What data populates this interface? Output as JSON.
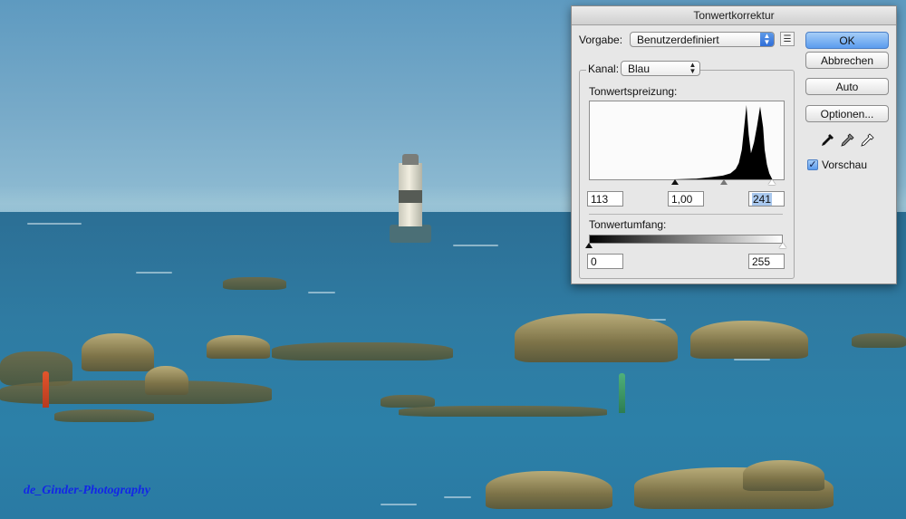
{
  "dialog": {
    "title": "Tonwertkorrektur",
    "preset_label": "Vorgabe:",
    "preset_value": "Benutzerdefiniert",
    "channel_label": "Kanal:",
    "channel_value": "Blau",
    "input_levels_label": "Tonwertspreizung:",
    "input_black": "113",
    "input_gamma": "1,00",
    "input_white": "241",
    "output_levels_label": "Tonwertumfang:",
    "output_black": "0",
    "output_white": "255",
    "buttons": {
      "ok": "OK",
      "cancel": "Abbrechen",
      "auto": "Auto",
      "options": "Optionen..."
    },
    "preview_label": "Vorschau",
    "preview_checked": true
  },
  "histogram": {
    "channel": "Blau",
    "levels": [
      [
        0,
        0
      ],
      [
        110,
        0
      ],
      [
        140,
        1
      ],
      [
        160,
        3
      ],
      [
        175,
        5
      ],
      [
        185,
        8
      ],
      [
        192,
        14
      ],
      [
        196,
        22
      ],
      [
        200,
        40
      ],
      [
        203,
        70
      ],
      [
        206,
        100
      ],
      [
        209,
        60
      ],
      [
        212,
        35
      ],
      [
        216,
        50
      ],
      [
        220,
        72
      ],
      [
        224,
        98
      ],
      [
        228,
        70
      ],
      [
        230,
        40
      ],
      [
        233,
        20
      ],
      [
        236,
        8
      ],
      [
        240,
        0
      ],
      [
        255,
        0
      ]
    ],
    "input_markers": [
      113,
      1.0,
      241
    ],
    "output_markers": [
      0,
      255
    ]
  },
  "photo": {
    "watermark": "de_Ginder-Photography",
    "colors": {
      "watermark": "#1327e6"
    }
  }
}
